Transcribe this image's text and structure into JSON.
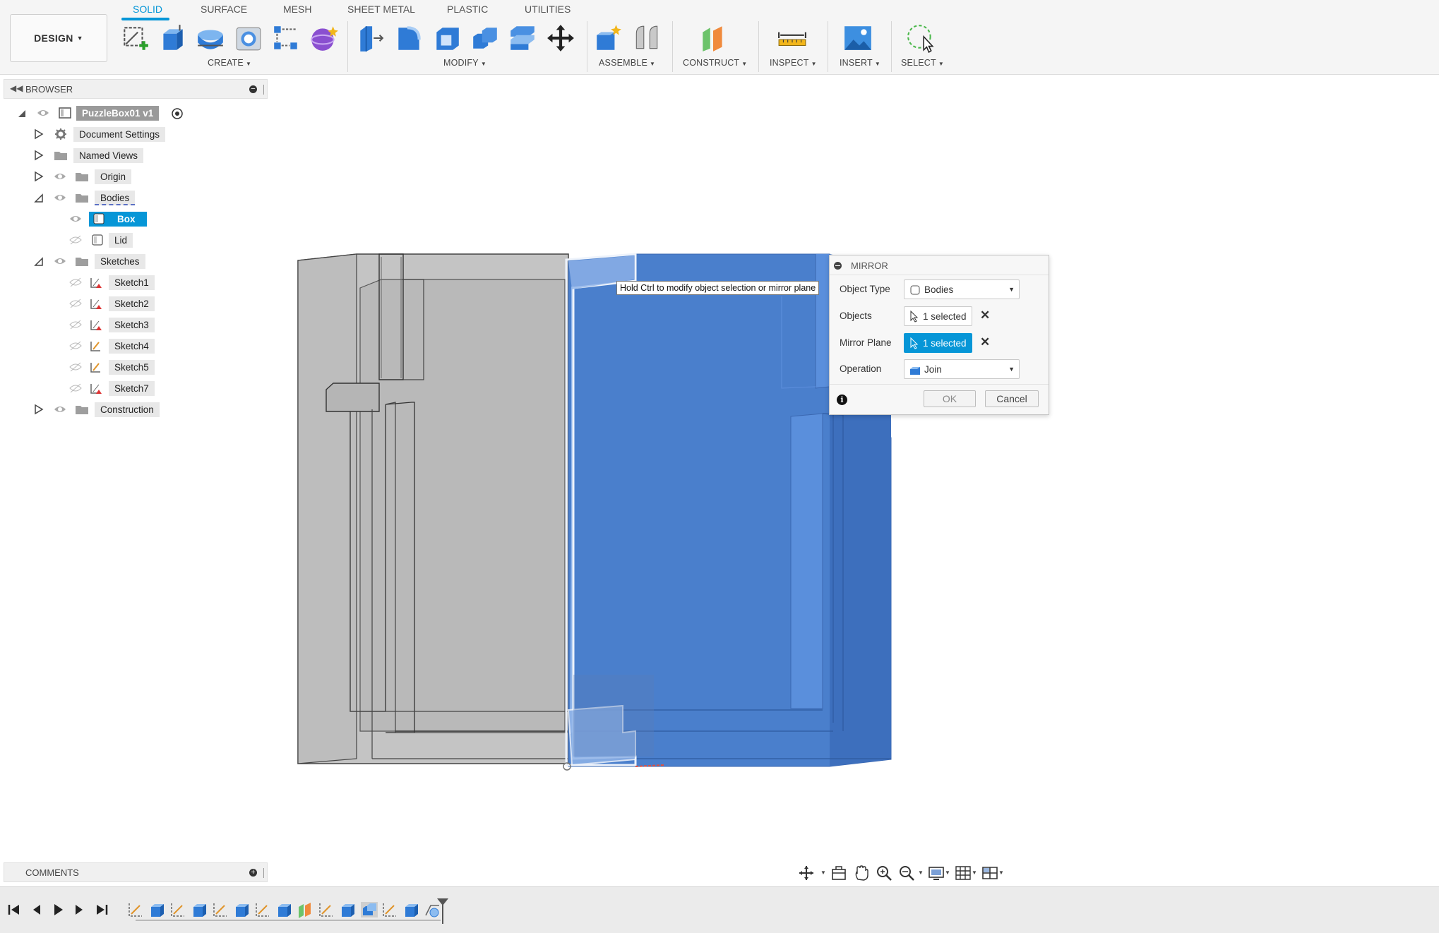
{
  "toolbar": {
    "workspace": "DESIGN",
    "tabs": [
      "SOLID",
      "SURFACE",
      "MESH",
      "SHEET METAL",
      "PLASTIC",
      "UTILITIES"
    ],
    "active_tab": "SOLID",
    "groups": {
      "create": "CREATE",
      "modify": "MODIFY",
      "assemble": "ASSEMBLE",
      "construct": "CONSTRUCT",
      "inspect": "INSPECT",
      "insert": "INSERT",
      "select": "SELECT"
    }
  },
  "browser": {
    "title": "BROWSER",
    "root": "PuzzleBox01 v1",
    "items": {
      "document_settings": "Document Settings",
      "named_views": "Named Views",
      "origin": "Origin",
      "bodies": "Bodies",
      "box": "Box",
      "lid": "Lid",
      "sketches": "Sketches",
      "sketch1": "Sketch1",
      "sketch2": "Sketch2",
      "sketch3": "Sketch3",
      "sketch4": "Sketch4",
      "sketch5": "Sketch5",
      "sketch7": "Sketch7",
      "construction": "Construction"
    }
  },
  "tooltip": "Hold Ctrl to modify object selection or mirror plane",
  "mirror_dialog": {
    "title": "MIRROR",
    "object_type_label": "Object Type",
    "object_type_value": "Bodies",
    "objects_label": "Objects",
    "objects_value": "1 selected",
    "mirror_plane_label": "Mirror Plane",
    "mirror_plane_value": "1 selected",
    "operation_label": "Operation",
    "operation_value": "Join",
    "ok": "OK",
    "cancel": "Cancel"
  },
  "comments": {
    "title": "COMMENTS"
  },
  "colors": {
    "accent": "#0696d7",
    "body_blue": "#4a7fcc",
    "body_grey": "#c4c4c4"
  }
}
